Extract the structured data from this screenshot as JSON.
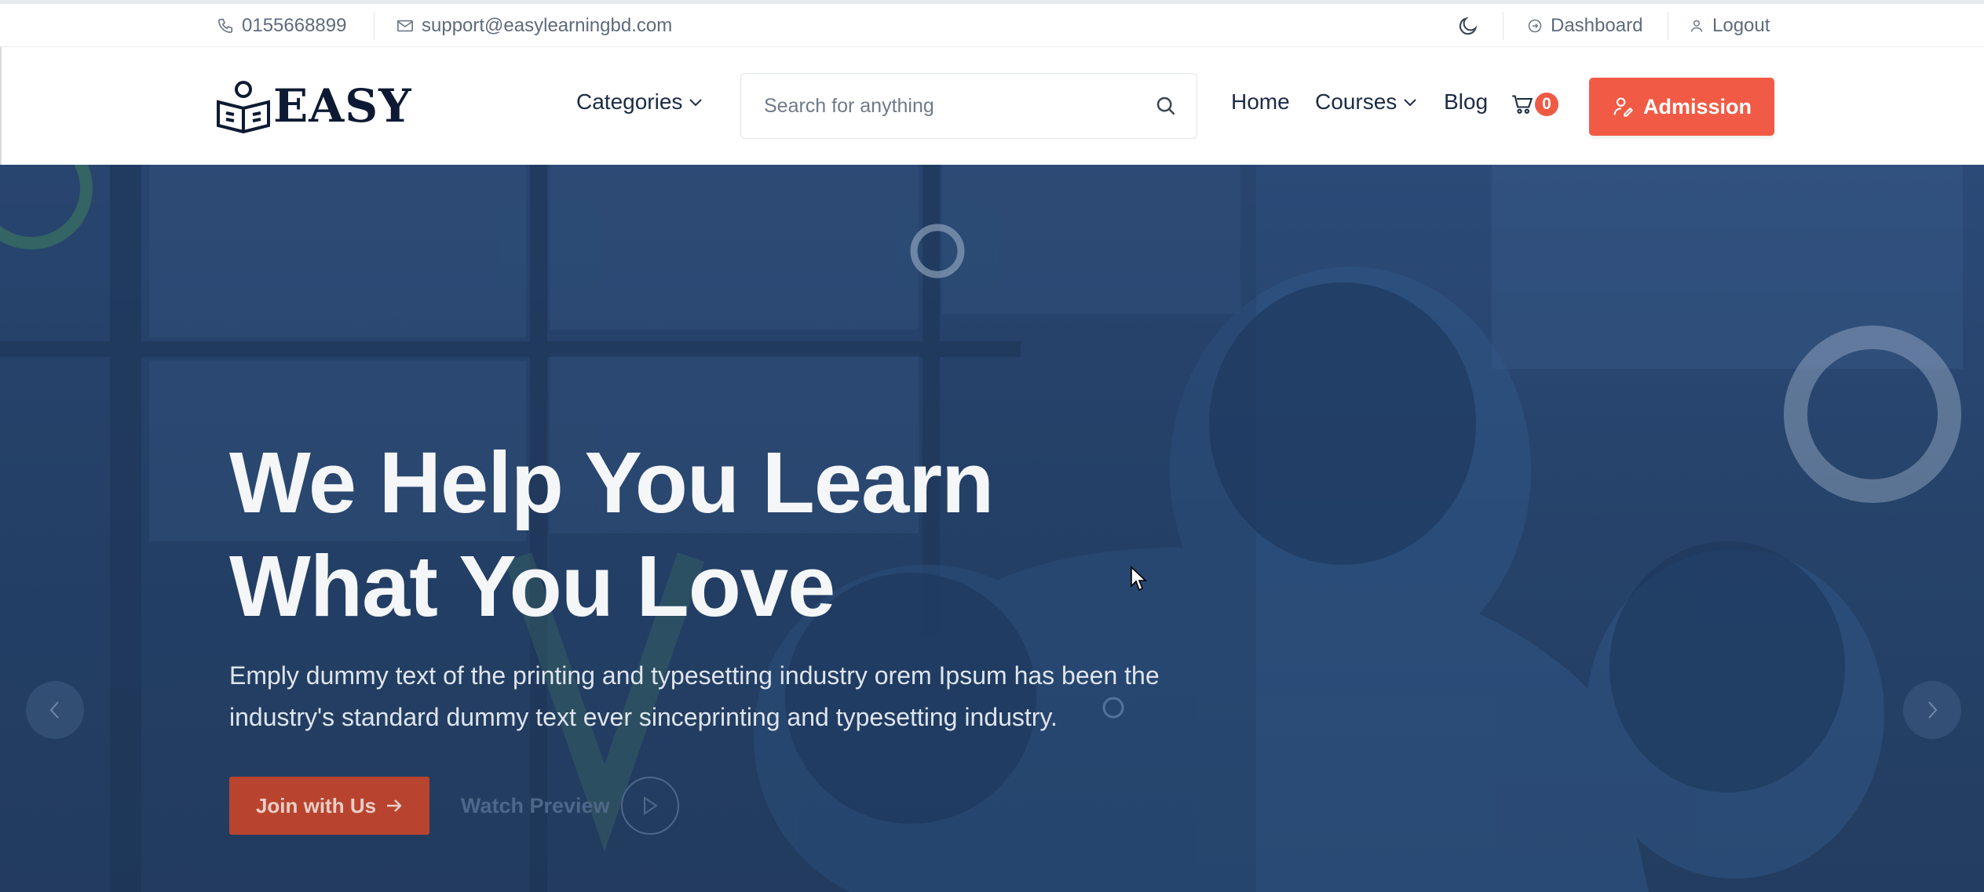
{
  "topbar": {
    "phone": "0155668899",
    "email": "support@easylearningbd.com",
    "dashboard_label": "Dashboard",
    "logout_label": "Logout"
  },
  "header": {
    "logo_text": "EASY",
    "categories_label": "Categories",
    "search_placeholder": "Search for anything",
    "nav": {
      "home": "Home",
      "courses": "Courses",
      "blog": "Blog"
    },
    "cart_count": "0",
    "admission_label": "Admission"
  },
  "hero": {
    "title_line1": "We Help You Learn",
    "title_line2": "What You Love",
    "subtitle_line1": "Emply dummy text of the printing and typesetting industry orem Ipsum has been the",
    "subtitle_line2": "industry's standard dummy text ever sinceprinting and typesetting industry.",
    "join_label": "Join with Us",
    "watch_label": "Watch Preview"
  },
  "colors": {
    "accent": "#f15b45",
    "hero_overlay": "#26436b",
    "text_dark": "#1c2b45"
  }
}
